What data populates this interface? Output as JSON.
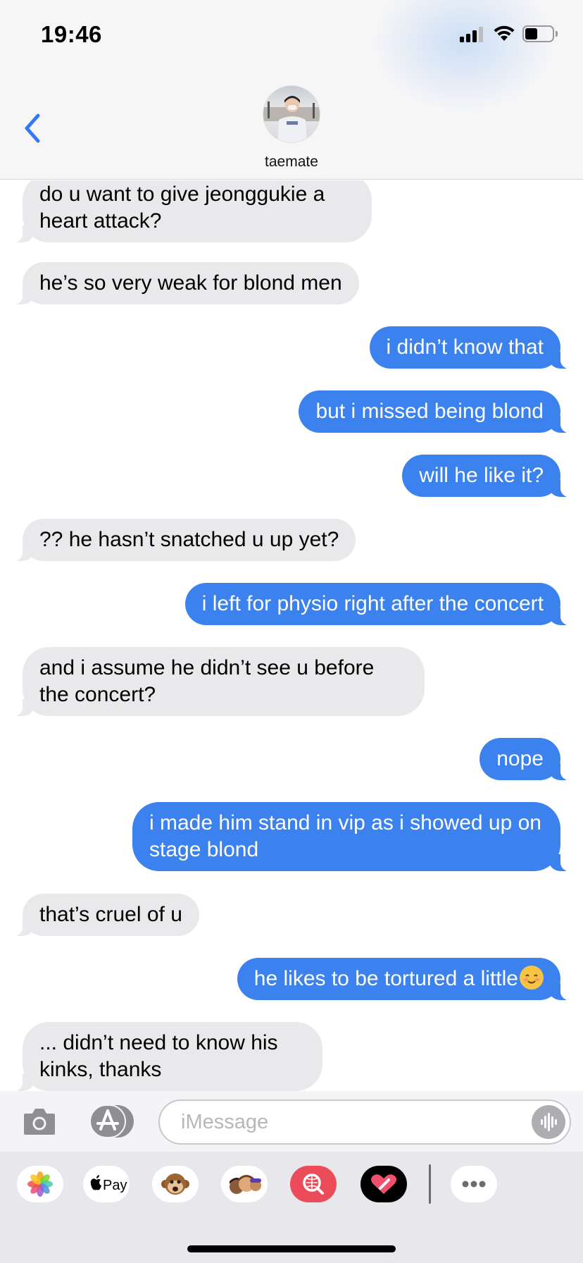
{
  "status_bar": {
    "time": "19:46",
    "signal_bars": 3,
    "battery_level": 0.45
  },
  "header": {
    "contact_name": "taemate",
    "back_icon": "chevron-left-icon"
  },
  "messages": [
    {
      "side": "in",
      "text": "do u want to give jeonggukie a heart attack?"
    },
    {
      "side": "in",
      "text": "he’s so very weak for blond men"
    },
    {
      "side": "out",
      "text": "i didn’t know that"
    },
    {
      "side": "out",
      "text": "but i missed being blond"
    },
    {
      "side": "out",
      "text": "will he like it?"
    },
    {
      "side": "in",
      "text": "?? he hasn’t snatched u up yet?"
    },
    {
      "side": "out",
      "text": "i left for physio right after the concert"
    },
    {
      "side": "in",
      "text": "and i assume he didn’t see u before the concert?"
    },
    {
      "side": "out",
      "text": "nope"
    },
    {
      "side": "out",
      "text": "i made him stand in vip as i showed up on stage blond"
    },
    {
      "side": "in",
      "text": "that’s cruel of u"
    },
    {
      "side": "out",
      "text": "he likes to be tortured a little",
      "emoji": "smiling-face-icon"
    },
    {
      "side": "in",
      "text": "... didn’t need to know his kinks, thanks"
    }
  ],
  "composer": {
    "placeholder": "iMessage",
    "camera_icon": "camera-icon",
    "apps_icon": "app-store-icon",
    "audio_icon": "audio-waveform-icon"
  },
  "app_drawer": {
    "apps": [
      {
        "name": "photos-icon"
      },
      {
        "name": "apple-pay-icon",
        "label": "Pay"
      },
      {
        "name": "animoji-monkey-icon"
      },
      {
        "name": "memoji-icon"
      },
      {
        "name": "web-search-icon"
      },
      {
        "name": "digital-touch-icon"
      },
      {
        "name": "more-icon"
      }
    ]
  },
  "colors": {
    "outgoing_bubble": "#3b82ef",
    "incoming_bubble": "#e9e9eb",
    "accent": "#3478f6"
  }
}
